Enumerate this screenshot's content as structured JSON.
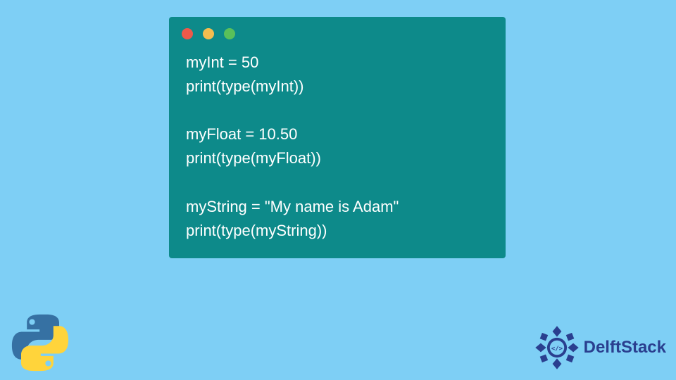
{
  "code_window": {
    "traffic_lights": [
      "red",
      "yellow",
      "green"
    ],
    "lines": [
      "myInt = 50",
      "print(type(myInt))",
      "",
      "myFloat = 10.50",
      "print(type(myFloat))",
      "",
      "myString = \"My name is Adam\"",
      "print(type(myString))"
    ]
  },
  "branding": {
    "site_name": "DelftStack"
  },
  "colors": {
    "background": "#7ecff5",
    "window": "#0d8a8a",
    "code_text": "#ffffff",
    "brand_text": "#2a3f8f"
  }
}
